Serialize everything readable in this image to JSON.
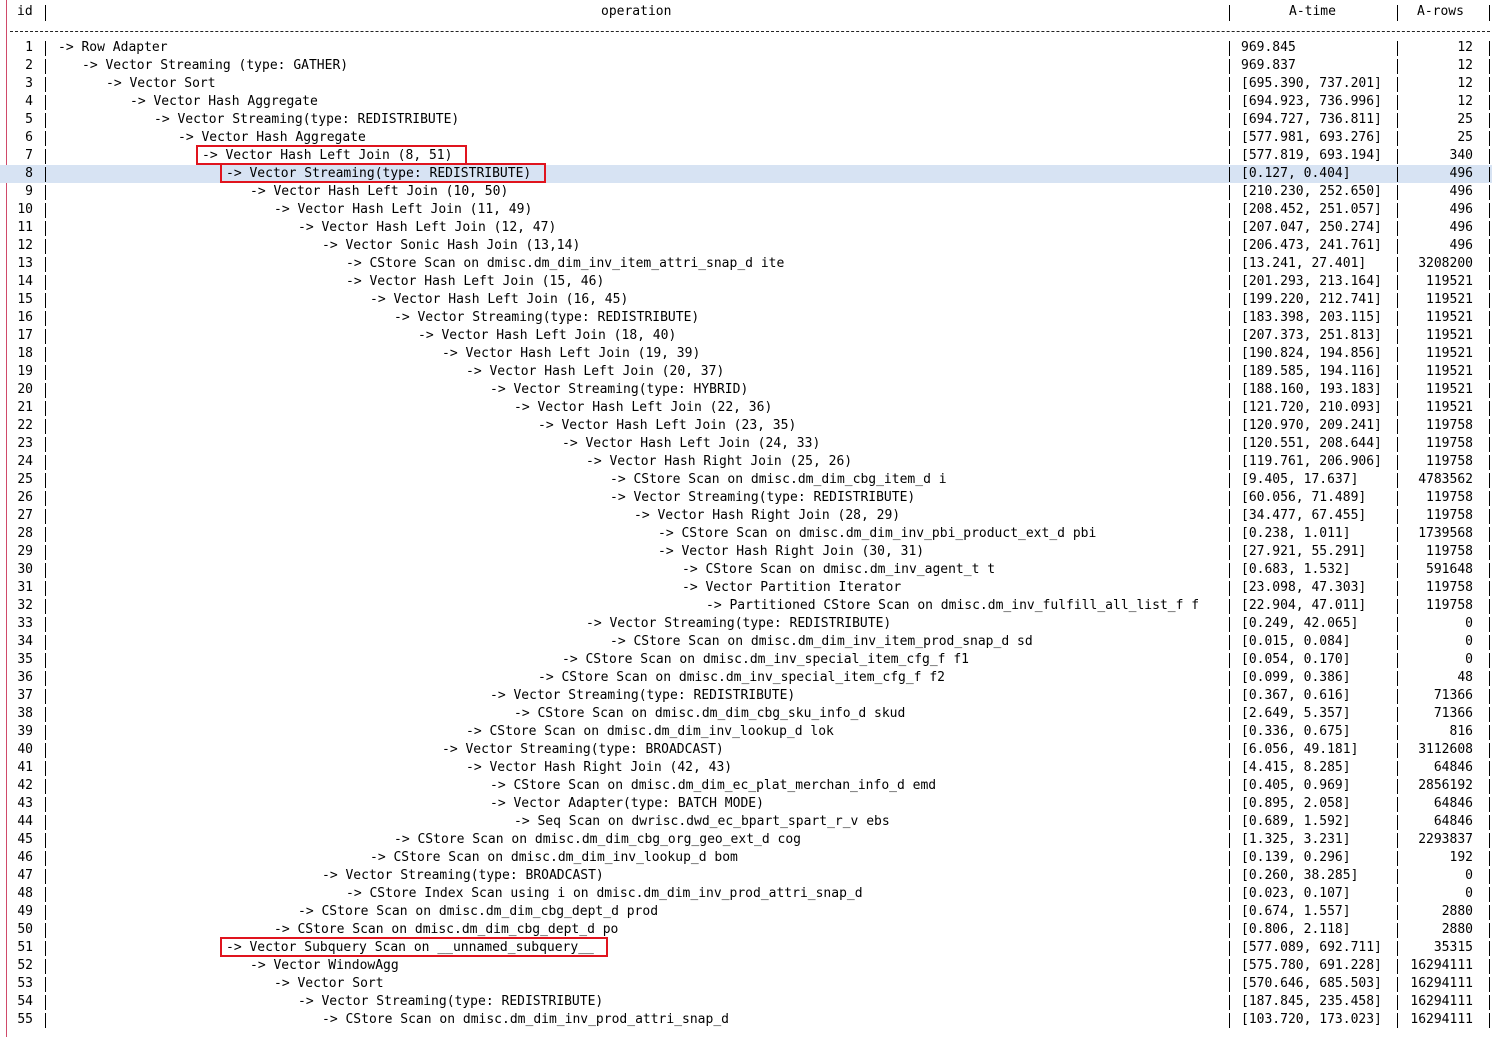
{
  "header": {
    "id": "id",
    "operation": "operation",
    "atime": "A-time",
    "arows": "A-rows"
  },
  "rows": [
    {
      "id": "1",
      "depth": 0,
      "op": "->  Row Adapter",
      "atime": "969.845",
      "arows": "12"
    },
    {
      "id": "2",
      "depth": 1,
      "op": "->  Vector Streaming (type: GATHER)",
      "atime": "969.837",
      "arows": "12"
    },
    {
      "id": "3",
      "depth": 2,
      "op": "->  Vector Sort",
      "atime": "[695.390, 737.201]",
      "arows": "12"
    },
    {
      "id": "4",
      "depth": 3,
      "op": "->  Vector Hash Aggregate",
      "atime": "[694.923, 736.996]",
      "arows": "12"
    },
    {
      "id": "5",
      "depth": 4,
      "op": "->  Vector Streaming(type: REDISTRIBUTE)",
      "atime": "[694.727, 736.811]",
      "arows": "25"
    },
    {
      "id": "6",
      "depth": 5,
      "op": "->  Vector Hash Aggregate",
      "atime": "[577.981, 693.276]",
      "arows": "25"
    },
    {
      "id": "7",
      "depth": 6,
      "op": "->  Vector Hash Left Join (8, 51)",
      "atime": "[577.819, 693.194]",
      "arows": "340"
    },
    {
      "id": "8",
      "depth": 7,
      "op": "->  Vector Streaming(type: REDISTRIBUTE)",
      "atime": "[0.127, 0.404]",
      "arows": "496",
      "highlight": true
    },
    {
      "id": "9",
      "depth": 8,
      "op": "->  Vector Hash Left Join (10, 50)",
      "atime": "[210.230, 252.650]",
      "arows": "496"
    },
    {
      "id": "10",
      "depth": 9,
      "op": "->  Vector Hash Left Join (11, 49)",
      "atime": "[208.452, 251.057]",
      "arows": "496"
    },
    {
      "id": "11",
      "depth": 10,
      "op": "->  Vector Hash Left Join (12, 47)",
      "atime": "[207.047, 250.274]",
      "arows": "496"
    },
    {
      "id": "12",
      "depth": 11,
      "op": "->  Vector Sonic Hash Join (13,14)",
      "atime": "[206.473, 241.761]",
      "arows": "496"
    },
    {
      "id": "13",
      "depth": 12,
      "op": "->  CStore Scan on dmisc.dm_dim_inv_item_attri_snap_d ite",
      "atime": "[13.241, 27.401]",
      "arows": "3208200"
    },
    {
      "id": "14",
      "depth": 12,
      "op": "->  Vector Hash Left Join (15, 46)",
      "atime": "[201.293, 213.164]",
      "arows": "119521"
    },
    {
      "id": "15",
      "depth": 13,
      "op": "->  Vector Hash Left Join (16, 45)",
      "atime": "[199.220, 212.741]",
      "arows": "119521"
    },
    {
      "id": "16",
      "depth": 14,
      "op": "->  Vector Streaming(type: REDISTRIBUTE)",
      "atime": "[183.398, 203.115]",
      "arows": "119521"
    },
    {
      "id": "17",
      "depth": 15,
      "op": "->  Vector Hash Left Join (18, 40)",
      "atime": "[207.373, 251.813]",
      "arows": "119521"
    },
    {
      "id": "18",
      "depth": 16,
      "op": "->  Vector Hash Left Join (19, 39)",
      "atime": "[190.824, 194.856]",
      "arows": "119521"
    },
    {
      "id": "19",
      "depth": 17,
      "op": "->  Vector Hash Left Join (20, 37)",
      "atime": "[189.585, 194.116]",
      "arows": "119521"
    },
    {
      "id": "20",
      "depth": 18,
      "op": "->  Vector Streaming(type: HYBRID)",
      "atime": "[188.160, 193.183]",
      "arows": "119521"
    },
    {
      "id": "21",
      "depth": 19,
      "op": "->  Vector Hash Left Join (22, 36)",
      "atime": "[121.720, 210.093]",
      "arows": "119521"
    },
    {
      "id": "22",
      "depth": 20,
      "op": "->  Vector Hash Left Join (23, 35)",
      "atime": "[120.970, 209.241]",
      "arows": "119758"
    },
    {
      "id": "23",
      "depth": 21,
      "op": "->  Vector Hash Left Join (24, 33)",
      "atime": "[120.551, 208.644]",
      "arows": "119758"
    },
    {
      "id": "24",
      "depth": 22,
      "op": "->  Vector Hash Right Join (25, 26)",
      "atime": "[119.761, 206.906]",
      "arows": "119758"
    },
    {
      "id": "25",
      "depth": 23,
      "op": "->  CStore Scan on dmisc.dm_dim_cbg_item_d i",
      "atime": "[9.405, 17.637]",
      "arows": "4783562"
    },
    {
      "id": "26",
      "depth": 23,
      "op": "->  Vector Streaming(type: REDISTRIBUTE)",
      "atime": "[60.056, 71.489]",
      "arows": "119758"
    },
    {
      "id": "27",
      "depth": 24,
      "op": "->  Vector Hash Right Join (28, 29)",
      "atime": "[34.477, 67.455]",
      "arows": "119758"
    },
    {
      "id": "28",
      "depth": 25,
      "op": "->  CStore Scan on dmisc.dm_dim_inv_pbi_product_ext_d pbi",
      "atime": "[0.238, 1.011]",
      "arows": "1739568"
    },
    {
      "id": "29",
      "depth": 25,
      "op": "->  Vector Hash Right Join (30, 31)",
      "atime": "[27.921, 55.291]",
      "arows": "119758"
    },
    {
      "id": "30",
      "depth": 26,
      "op": "->  CStore Scan on dmisc.dm_inv_agent_t t",
      "atime": "[0.683, 1.532]",
      "arows": "591648"
    },
    {
      "id": "31",
      "depth": 26,
      "op": "->  Vector Partition Iterator",
      "atime": "[23.098, 47.303]",
      "arows": "119758"
    },
    {
      "id": "32",
      "depth": 27,
      "op": "->  Partitioned CStore Scan on dmisc.dm_inv_fulfill_all_list_f f",
      "atime": "[22.904, 47.011]",
      "arows": "119758"
    },
    {
      "id": "33",
      "depth": 22,
      "op": "->  Vector Streaming(type: REDISTRIBUTE)",
      "atime": "[0.249, 42.065]",
      "arows": "0"
    },
    {
      "id": "34",
      "depth": 23,
      "op": "->  CStore Scan on dmisc.dm_dim_inv_item_prod_snap_d sd",
      "atime": "[0.015, 0.084]",
      "arows": "0"
    },
    {
      "id": "35",
      "depth": 21,
      "op": "->  CStore Scan on dmisc.dm_inv_special_item_cfg_f f1",
      "atime": "[0.054, 0.170]",
      "arows": "0"
    },
    {
      "id": "36",
      "depth": 20,
      "op": "->  CStore Scan on dmisc.dm_inv_special_item_cfg_f f2",
      "atime": "[0.099, 0.386]",
      "arows": "48"
    },
    {
      "id": "37",
      "depth": 18,
      "op": "->  Vector Streaming(type: REDISTRIBUTE)",
      "atime": "[0.367, 0.616]",
      "arows": "71366"
    },
    {
      "id": "38",
      "depth": 19,
      "op": "->  CStore Scan on dmisc.dm_dim_cbg_sku_info_d skud",
      "atime": "[2.649, 5.357]",
      "arows": "71366"
    },
    {
      "id": "39",
      "depth": 17,
      "op": "->  CStore Scan on dmisc.dm_dim_inv_lookup_d lok",
      "atime": "[0.336, 0.675]",
      "arows": "816"
    },
    {
      "id": "40",
      "depth": 16,
      "op": "->  Vector Streaming(type: BROADCAST)",
      "atime": "[6.056, 49.181]",
      "arows": "3112608"
    },
    {
      "id": "41",
      "depth": 17,
      "op": "->  Vector Hash Right Join (42, 43)",
      "atime": "[4.415, 8.285]",
      "arows": "64846"
    },
    {
      "id": "42",
      "depth": 18,
      "op": "->  CStore Scan on dmisc.dm_dim_ec_plat_merchan_info_d emd",
      "atime": "[0.405, 0.969]",
      "arows": "2856192"
    },
    {
      "id": "43",
      "depth": 18,
      "op": "->  Vector Adapter(type: BATCH MODE)",
      "atime": "[0.895, 2.058]",
      "arows": "64846"
    },
    {
      "id": "44",
      "depth": 19,
      "op": "->  Seq Scan on dwrisc.dwd_ec_bpart_spart_r_v ebs",
      "atime": "[0.689, 1.592]",
      "arows": "64846"
    },
    {
      "id": "45",
      "depth": 14,
      "op": "->  CStore Scan on dmisc.dm_dim_cbg_org_geo_ext_d cog",
      "atime": "[1.325, 3.231]",
      "arows": "2293837"
    },
    {
      "id": "46",
      "depth": 13,
      "op": "->  CStore Scan on dmisc.dm_dim_inv_lookup_d bom",
      "atime": "[0.139, 0.296]",
      "arows": "192"
    },
    {
      "id": "47",
      "depth": 11,
      "op": "->  Vector Streaming(type: BROADCAST)",
      "atime": "[0.260, 38.285]",
      "arows": "0"
    },
    {
      "id": "48",
      "depth": 12,
      "op": "->  CStore Index Scan using i on dmisc.dm_dim_inv_prod_attri_snap_d",
      "atime": "[0.023, 0.107]",
      "arows": "0"
    },
    {
      "id": "49",
      "depth": 10,
      "op": "->  CStore Scan on dmisc.dm_dim_cbg_dept_d prod",
      "atime": "[0.674, 1.557]",
      "arows": "2880"
    },
    {
      "id": "50",
      "depth": 9,
      "op": "->  CStore Scan on dmisc.dm_dim_cbg_dept_d po",
      "atime": "[0.806, 2.118]",
      "arows": "2880"
    },
    {
      "id": "51",
      "depth": 7,
      "op": "->  Vector Subquery Scan on __unnamed_subquery__",
      "atime": "[577.089, 692.711]",
      "arows": "35315"
    },
    {
      "id": "52",
      "depth": 8,
      "op": "->  Vector WindowAgg",
      "atime": "[575.780, 691.228]",
      "arows": "16294111"
    },
    {
      "id": "53",
      "depth": 9,
      "op": "->  Vector Sort",
      "atime": "[570.646, 685.503]",
      "arows": "16294111"
    },
    {
      "id": "54",
      "depth": 10,
      "op": "->  Vector Streaming(type: REDISTRIBUTE)",
      "atime": "[187.845, 235.458]",
      "arows": "16294111"
    },
    {
      "id": "55",
      "depth": 11,
      "op": "->  CStore Scan on dmisc.dm_dim_inv_prod_attri_snap_d",
      "atime": "[103.720, 173.023]",
      "arows": "16294111"
    }
  ],
  "highlight_boxes": [
    7,
    8,
    51
  ],
  "colors": {
    "highlight_row": "#d7e3f3",
    "annotation_box": "#e0141e",
    "left_rule": "#d04a6a"
  }
}
